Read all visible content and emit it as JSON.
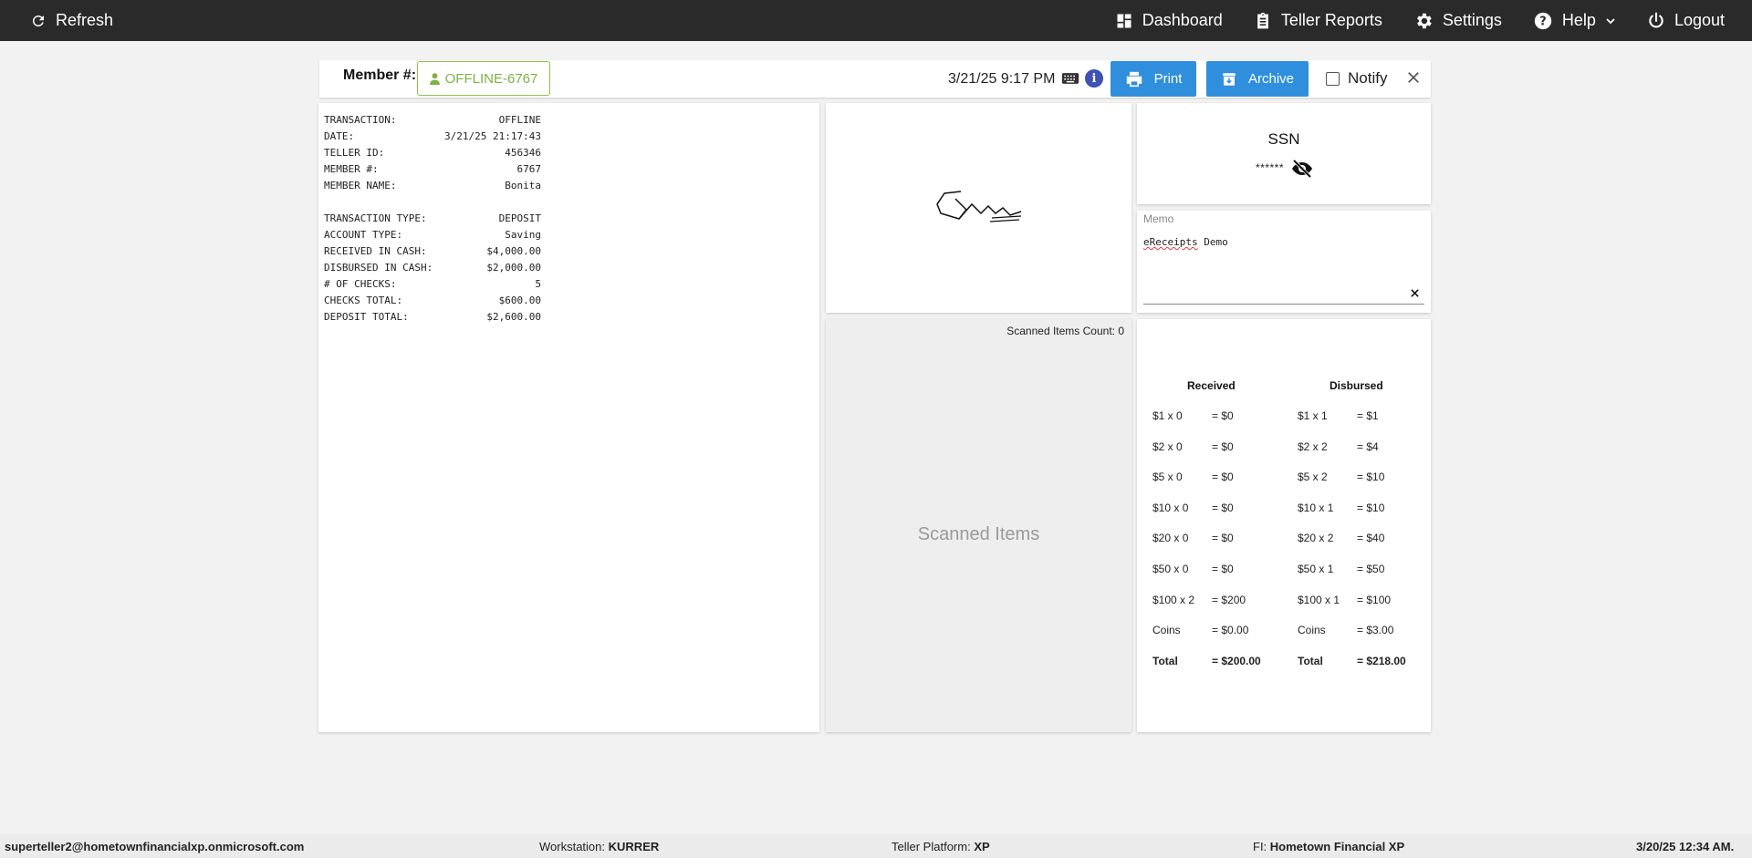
{
  "topbar": {
    "refresh_label": "Refresh",
    "nav": [
      {
        "label": "Dashboard",
        "icon": "dashboard-icon"
      },
      {
        "label": "Teller Reports",
        "icon": "clipboard-icon"
      },
      {
        "label": "Settings",
        "icon": "gear-icon"
      },
      {
        "label": "Help",
        "icon": "help-icon"
      },
      {
        "label": "Logout",
        "icon": "power-icon"
      }
    ]
  },
  "header": {
    "member_label": "Member #:",
    "member_value": "OFFLINE-6767",
    "datetime": "3/21/25 9:17 PM",
    "print_label": "Print",
    "archive_label": "Archive",
    "notify_label": "Notify"
  },
  "receipt": {
    "section1": [
      {
        "k": "TRANSACTION:",
        "v": "OFFLINE"
      },
      {
        "k": "DATE:",
        "v": "3/21/25 21:17:43"
      },
      {
        "k": "TELLER ID:",
        "v": "456346"
      },
      {
        "k": "MEMBER #:",
        "v": "6767"
      },
      {
        "k": "MEMBER NAME:",
        "v": "Bonita"
      }
    ],
    "section2": [
      {
        "k": "TRANSACTION TYPE:",
        "v": "DEPOSIT"
      },
      {
        "k": "ACCOUNT TYPE:",
        "v": "Saving"
      },
      {
        "k": "RECEIVED IN CASH:",
        "v": "$4,000.00"
      },
      {
        "k": "DISBURSED IN CASH:",
        "v": "$2,000.00"
      },
      {
        "k": "# OF CHECKS:",
        "v": "5"
      },
      {
        "k": "CHECKS TOTAL:",
        "v": "$600.00"
      },
      {
        "k": "DEPOSIT TOTAL:",
        "v": "$2,600.00"
      }
    ]
  },
  "scanned": {
    "count_label": "Scanned Items Count: 0",
    "title": "Scanned Items"
  },
  "ssn": {
    "title": "SSN",
    "masked": "******"
  },
  "memo": {
    "label": "Memo",
    "text_word1": "eReceipts",
    "text_word2": " Demo"
  },
  "cash": {
    "received_header": "Received",
    "disbursed_header": "Disbursed",
    "received": [
      {
        "d": "$1 x 0",
        "t": "= $0"
      },
      {
        "d": "$2 x 0",
        "t": "= $0"
      },
      {
        "d": "$5 x 0",
        "t": "= $0"
      },
      {
        "d": "$10 x 0",
        "t": "= $0"
      },
      {
        "d": "$20 x 0",
        "t": "= $0"
      },
      {
        "d": "$50 x 0",
        "t": "= $0"
      },
      {
        "d": "$100 x 2",
        "t": "= $200"
      },
      {
        "d": "Coins",
        "t": "= $0.00"
      },
      {
        "d": "Total",
        "t": "= $200.00"
      }
    ],
    "disbursed": [
      {
        "d": "$1 x 1",
        "t": "= $1"
      },
      {
        "d": "$2 x 2",
        "t": "= $4"
      },
      {
        "d": "$5 x 2",
        "t": "= $10"
      },
      {
        "d": "$10 x 1",
        "t": "= $10"
      },
      {
        "d": "$20 x 2",
        "t": "= $40"
      },
      {
        "d": "$50 x 1",
        "t": "= $50"
      },
      {
        "d": "$100 x 1",
        "t": "= $100"
      },
      {
        "d": "Coins",
        "t": "= $3.00"
      },
      {
        "d": "Total",
        "t": "= $218.00"
      }
    ]
  },
  "footer": {
    "user": "superteller2@hometownfinancialxp.onmicrosoft.com",
    "workstation_label": "Workstation:",
    "workstation": "KURRER",
    "platform_label": "Teller Platform:",
    "platform": "XP",
    "fi_label": "FI:",
    "fi": "Hometown Financial XP",
    "datetime": "3/20/25 12:34 AM."
  },
  "colors": {
    "topbar": "#2a2a2a",
    "primary_button": "#2f8fdc",
    "member_accent": "#7cb342",
    "info": "#3f51b5"
  }
}
